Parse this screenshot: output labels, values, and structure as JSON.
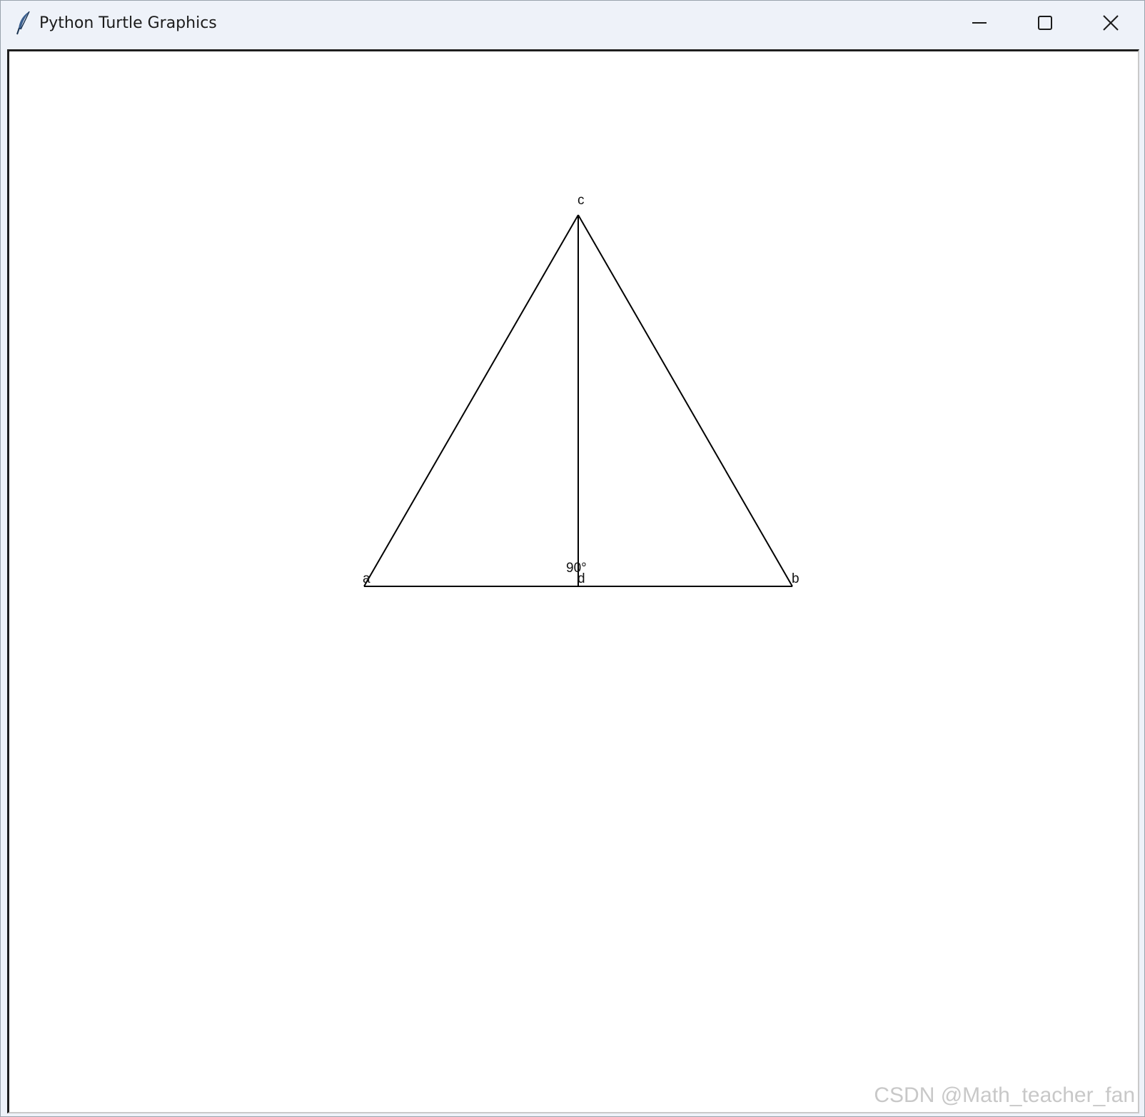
{
  "window": {
    "title": "Python Turtle Graphics",
    "app_icon": "feather-icon",
    "controls": {
      "minimize_icon": "minimize-icon",
      "maximize_icon": "maximize-icon",
      "close_icon": "close-icon"
    }
  },
  "canvas": {
    "background": "#ffffff",
    "stroke_color": "#000000",
    "labels": {
      "a": "a",
      "b": "b",
      "c": "c",
      "d": "d",
      "angle": "90°"
    }
  },
  "watermark": "CSDN @Math_teacher_fan"
}
